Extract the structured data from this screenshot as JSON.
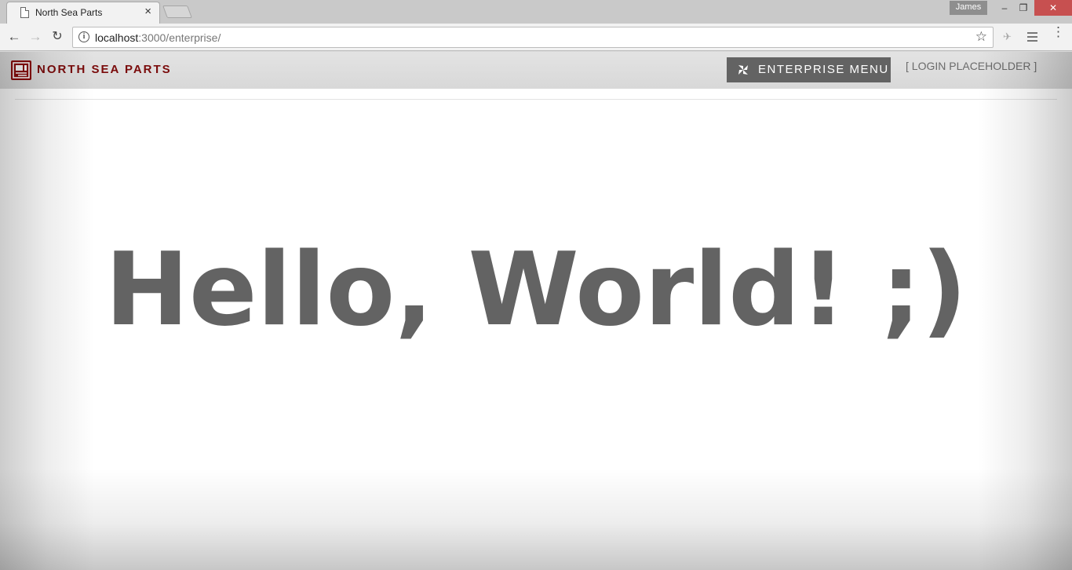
{
  "browser": {
    "tab_title": "North Sea Parts",
    "tab_close": "×",
    "profile_name": "James",
    "window_buttons": {
      "minimize": "–",
      "restore": "❐",
      "close": "✕"
    },
    "nav": {
      "back": "←",
      "forward": "→",
      "reload": "↻"
    },
    "url_host": "localhost",
    "url_rest": ":3000/enterprise/",
    "info_glyph": "i",
    "star_glyph": "☆",
    "menu_glyph": "⋮"
  },
  "site": {
    "brand": "NORTH SEA PARTS",
    "brand_color": "#7a0b0b",
    "enterprise_menu_label": "ENTERPRISE MENU",
    "enterprise_menu_icon": "pinwheel-icon",
    "login_placeholder": "[ LOGIN PLACEHOLDER ]"
  },
  "main": {
    "heading": "Hello, World! ;)"
  }
}
